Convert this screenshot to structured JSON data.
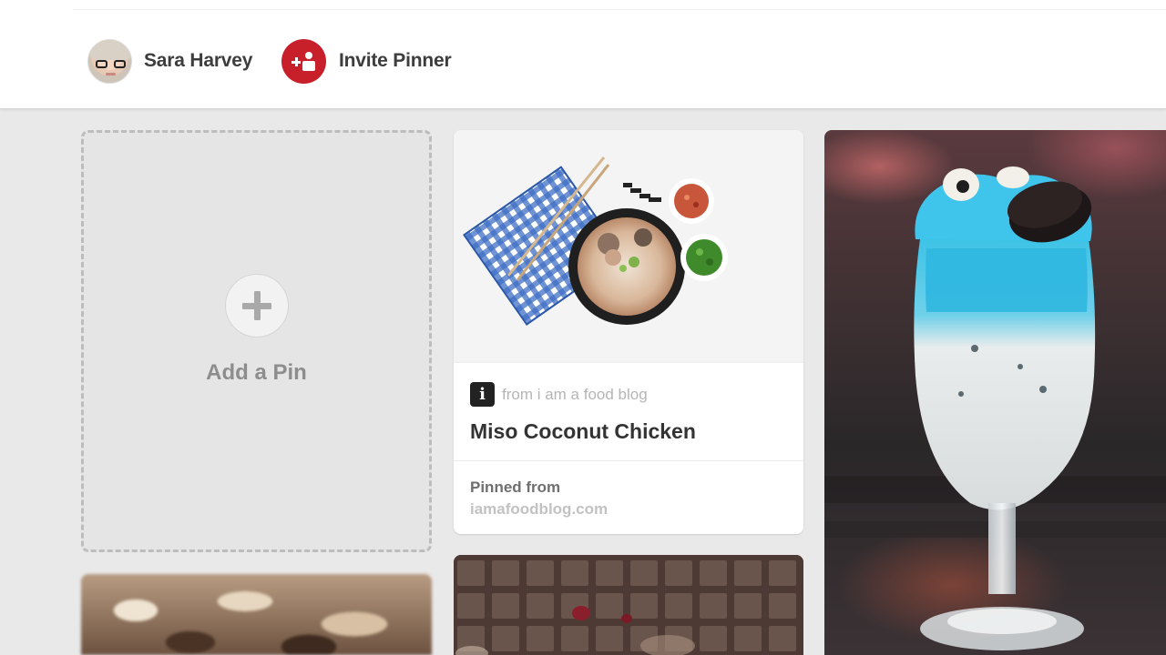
{
  "header": {
    "user_name": "Sara Harvey",
    "invite_label": "Invite Pinner"
  },
  "add_pin": {
    "label": "Add a Pin"
  },
  "pin": {
    "source_icon_letter": "i",
    "source_text": "from i am a food blog",
    "title": "Miso Coconut Chicken",
    "pinned_from_label": "Pinned from",
    "pinned_domain": "iamafoodblog.com"
  },
  "colors": {
    "brand_red": "#c8202b",
    "background": "#e9e9e9"
  },
  "icons": {
    "invite": "invite-person-plus-icon",
    "add": "plus-icon",
    "source": "info-letter-icon"
  }
}
